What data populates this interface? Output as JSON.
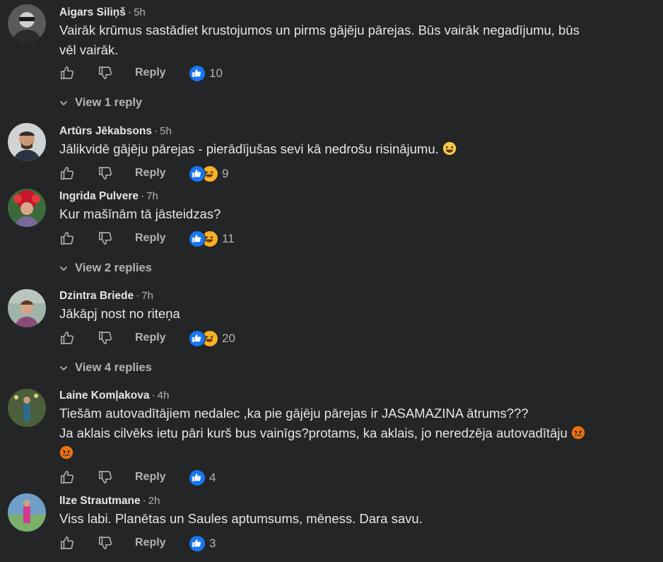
{
  "labels": {
    "reply": "Reply"
  },
  "colors": {
    "background": "#242526",
    "like": "#1877f2",
    "haha": "#f7b125",
    "angry": "#e9710f",
    "muted": "#b0b3b8"
  },
  "comments": [
    {
      "author": "Aigars Siliņš",
      "time": "5h",
      "lines": [
        "Vairāk krūmus sastādiet krustojumos un pirms gājēju pārejas. Būs vairāk negadījumu, būs",
        "vēl vairāk."
      ],
      "reactions": [
        "like"
      ],
      "count": "10",
      "view_replies": "View 1 reply"
    },
    {
      "author": "Artūrs Jēkabsons",
      "time": "5h",
      "lines": [
        "Jālikvidē gājēju pārejas - pierādījušas sevi kā nedrošu risinājumu."
      ],
      "emoji": "laughing-emoji",
      "reactions": [
        "like",
        "haha"
      ],
      "count": "9"
    },
    {
      "author": "Ingrida Pulvere",
      "time": "7h",
      "lines": [
        "Kur mašīnām tā jāsteidzas?"
      ],
      "reactions": [
        "like",
        "haha"
      ],
      "count": "11",
      "view_replies": "View 2 replies"
    },
    {
      "author": "Dzintra Briede",
      "time": "7h",
      "lines": [
        "Jākāpj nost no riteņa"
      ],
      "reactions": [
        "like",
        "haha"
      ],
      "count": "20",
      "view_replies": "View 4 replies"
    },
    {
      "author": "Laine Komļakova",
      "time": "4h",
      "lines": [
        "Tiešām autovadītājiem nedalec ,ka pie gājēju pārejas ir JASAMAZINA ātrums???",
        "Ja aklais cilvēks ietu pāri kurš bus vainīgs?protams, ka aklais, jo neredzēja autovadītāju"
      ],
      "emoji": "angry-face-emoji",
      "reactions": [
        "like"
      ],
      "count": "4"
    },
    {
      "author": "Ilze Strautmane",
      "time": "2h",
      "lines": [
        "Viss labi. Planētas un Saules aptumsums, mēness. Dara savu."
      ],
      "reactions": [
        "like"
      ],
      "count": "3"
    }
  ]
}
